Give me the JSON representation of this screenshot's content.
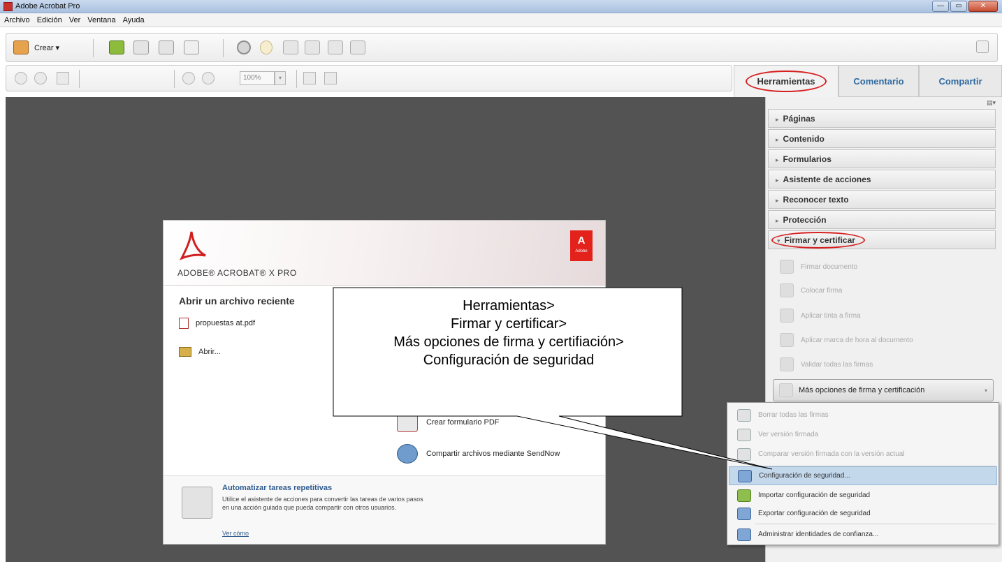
{
  "window": {
    "title": "Adobe Acrobat Pro",
    "buttons": {
      "minimize": "—",
      "maximize": "▭",
      "close": "✕"
    }
  },
  "menubar": [
    "Archivo",
    "Edición",
    "Ver",
    "Ventana",
    "Ayuda"
  ],
  "toolbar": {
    "crear_label": "Crear ▾",
    "zoom_value": "100%",
    "zoom_arrow": "▾"
  },
  "tabs": {
    "herramientas": "Herramientas",
    "comentario": "Comentario",
    "compartir": "Compartir"
  },
  "tools_panel": {
    "options_icon": "▤▾",
    "sections": [
      {
        "label": "Páginas"
      },
      {
        "label": "Contenido"
      },
      {
        "label": "Formularios"
      },
      {
        "label": "Asistente de acciones"
      },
      {
        "label": "Reconocer texto"
      },
      {
        "label": "Protección"
      },
      {
        "label": "Firmar y certificar"
      }
    ],
    "sign_items": [
      "Firmar documento",
      "Colocar firma",
      "Aplicar tinta a firma",
      "Aplicar marca de hora al documento",
      "Validar todas las firmas"
    ],
    "more_options_button": "Más opciones de firma y certificación",
    "more_options_arrow": "▾"
  },
  "dropdown": {
    "items": [
      {
        "label": "Borrar todas las firmas",
        "state": "disabled"
      },
      {
        "label": "Ver versión firmada",
        "state": "disabled"
      },
      {
        "label": "Comparar versión firmada con la versión actual",
        "state": "disabled"
      },
      {
        "label": "Configuración de seguridad...",
        "state": "highlighted"
      },
      {
        "label": "Importar configuración de seguridad",
        "state": "enabled"
      },
      {
        "label": "Exportar configuración de seguridad",
        "state": "enabled"
      },
      {
        "label": "Administrar identidades de confianza...",
        "state": "enabled"
      }
    ]
  },
  "welcome": {
    "brand": "ADOBE® ACROBAT® X PRO",
    "adobe_tag": "A",
    "adobe_tag_small": "Adobe",
    "recent_title": "Abrir un archivo reciente",
    "recent_file": "propuestas at.pdf",
    "open_label": "Abrir...",
    "actions": [
      {
        "label": "Crear formulario PDF"
      },
      {
        "label": "Compartir archivos mediante SendNow"
      }
    ],
    "bottom": {
      "title": "Automatizar tareas repetitivas",
      "text": "Utilice el asistente de acciones para convertir las tareas de varios pasos en una acción guiada que pueda compartir con otros usuarios.",
      "link": "Ver cómo"
    }
  },
  "callout": {
    "lines": [
      "Herramientas>",
      "Firmar y certificar>",
      "Más opciones de firma y certifiación>",
      "Configuración de seguridad"
    ]
  },
  "colors": {
    "doc_background": "#535353",
    "highlight_red": "#d62020",
    "tab_link": "#2f6aa0",
    "menu_highlight": "#c4d8ec"
  }
}
